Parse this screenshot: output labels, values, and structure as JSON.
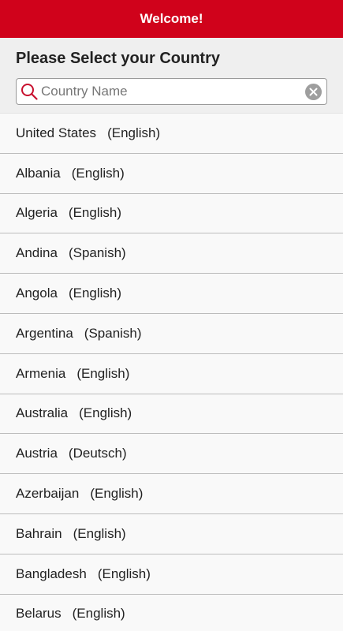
{
  "topbar": {
    "title": "Welcome!"
  },
  "header": {
    "heading": "Please Select your Country"
  },
  "search": {
    "placeholder": "Country Name",
    "value": ""
  },
  "colors": {
    "brand": "#d0021b",
    "search_icon": "#c8102e",
    "clear_icon": "#9e9e9e"
  },
  "countries": [
    {
      "name": "United States",
      "language": "(English)"
    },
    {
      "name": "Albania",
      "language": "(English)"
    },
    {
      "name": "Algeria",
      "language": "(English)"
    },
    {
      "name": "Andina",
      "language": "(Spanish)"
    },
    {
      "name": "Angola",
      "language": "(English)"
    },
    {
      "name": "Argentina",
      "language": "(Spanish)"
    },
    {
      "name": "Armenia",
      "language": "(English)"
    },
    {
      "name": "Australia",
      "language": "(English)"
    },
    {
      "name": "Austria",
      "language": "(Deutsch)"
    },
    {
      "name": "Azerbaijan",
      "language": "(English)"
    },
    {
      "name": "Bahrain",
      "language": "(English)"
    },
    {
      "name": "Bangladesh",
      "language": "(English)"
    },
    {
      "name": "Belarus",
      "language": "(English)"
    }
  ]
}
